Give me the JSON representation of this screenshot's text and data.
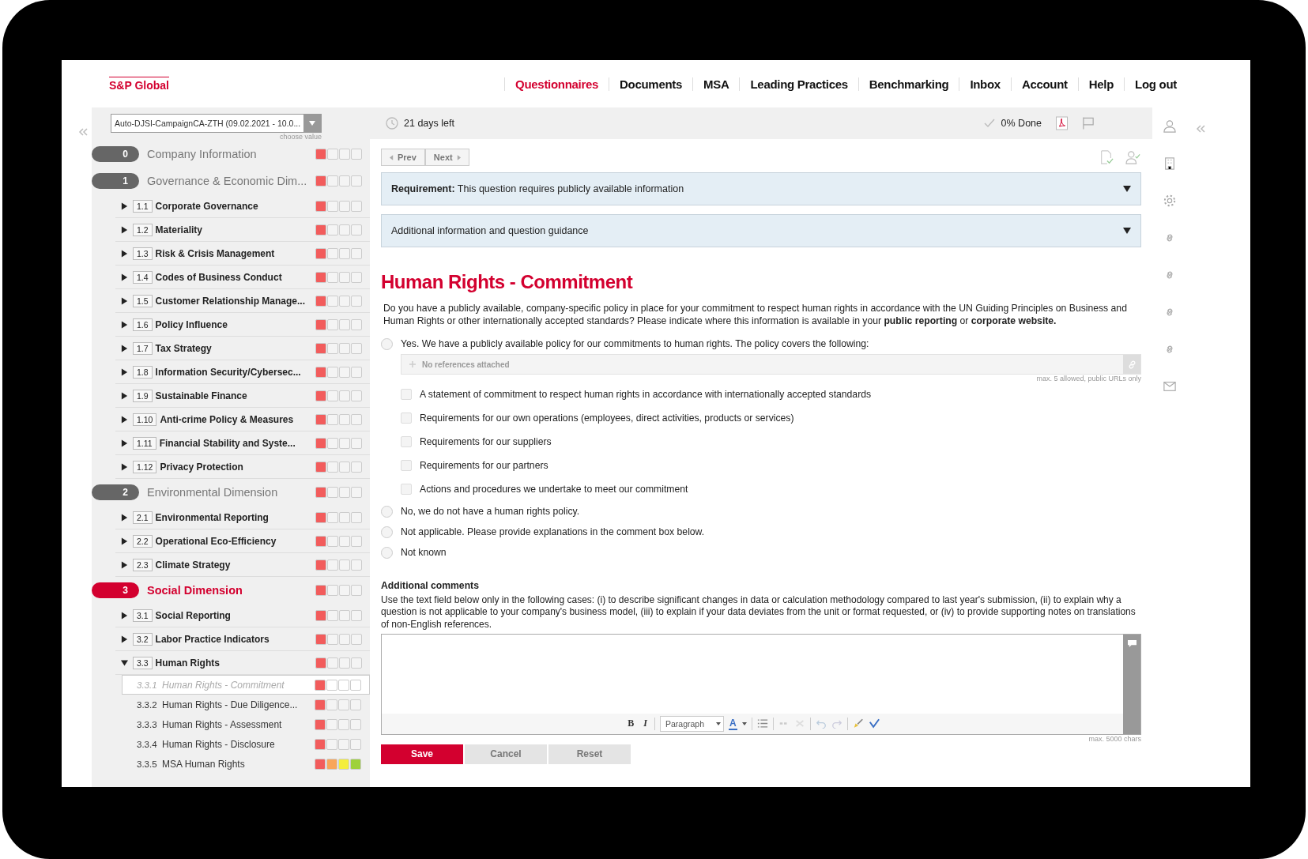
{
  "logo": "S&P Global",
  "nav": [
    {
      "label": "Questionnaires",
      "selected": true
    },
    {
      "label": "Documents",
      "selected": false
    },
    {
      "label": "MSA",
      "selected": false
    },
    {
      "label": "Leading Practices",
      "selected": false
    },
    {
      "label": "Benchmarking",
      "selected": false
    },
    {
      "label": "Inbox",
      "selected": false
    },
    {
      "label": "Account",
      "selected": false
    },
    {
      "label": "Help",
      "selected": false
    },
    {
      "label": "Log out",
      "selected": false
    }
  ],
  "sidebar": {
    "campaign_select": {
      "value": "Auto-DJSI-CampaignCA-ZTH (09.02.2021 - 10.0...",
      "hint": "choose value"
    },
    "sections": [
      {
        "number": "0",
        "title": "Company Information",
        "selected": false,
        "squares": [
          {
            "color": "#f25c5c"
          },
          {
            "color": "#f4f4f4"
          },
          {
            "color": "#f4f4f4"
          },
          {
            "color": "#f4f4f4"
          }
        ]
      },
      {
        "number": "1",
        "title": "Governance & Economic Dim...",
        "selected": false,
        "squares": [
          {
            "color": "#f25c5c"
          },
          {
            "color": "#f4f4f4"
          },
          {
            "color": "#f4f4f4"
          },
          {
            "color": "#f4f4f4"
          }
        ],
        "children": [
          {
            "number": "1.1",
            "title": "Corporate Governance",
            "expanded": false,
            "squares": [
              {
                "color": "#f25c5c"
              },
              {
                "color": "#f4f4f4"
              },
              {
                "color": "#f4f4f4"
              },
              {
                "color": "#f4f4f4"
              }
            ]
          },
          {
            "number": "1.2",
            "title": "Materiality",
            "expanded": false,
            "squares": [
              {
                "color": "#f25c5c"
              },
              {
                "color": "#f4f4f4"
              },
              {
                "color": "#f4f4f4"
              },
              {
                "color": "#f4f4f4"
              }
            ]
          },
          {
            "number": "1.3",
            "title": "Risk & Crisis Management",
            "expanded": false,
            "squares": [
              {
                "color": "#f25c5c"
              },
              {
                "color": "#f4f4f4"
              },
              {
                "color": "#f4f4f4"
              },
              {
                "color": "#f4f4f4"
              }
            ]
          },
          {
            "number": "1.4",
            "title": "Codes of Business Conduct",
            "expanded": false,
            "squares": [
              {
                "color": "#f25c5c"
              },
              {
                "color": "#f4f4f4"
              },
              {
                "color": "#f4f4f4"
              },
              {
                "color": "#f4f4f4"
              }
            ]
          },
          {
            "number": "1.5",
            "title": "Customer Relationship Manage...",
            "expanded": false,
            "squares": [
              {
                "color": "#f25c5c"
              },
              {
                "color": "#f4f4f4"
              },
              {
                "color": "#f4f4f4"
              },
              {
                "color": "#f4f4f4"
              }
            ]
          },
          {
            "number": "1.6",
            "title": "Policy Influence",
            "expanded": false,
            "squares": [
              {
                "color": "#f25c5c"
              },
              {
                "color": "#f4f4f4"
              },
              {
                "color": "#f4f4f4"
              },
              {
                "color": "#f4f4f4"
              }
            ]
          },
          {
            "number": "1.7",
            "title": "Tax Strategy",
            "expanded": false,
            "squares": [
              {
                "color": "#f25c5c"
              },
              {
                "color": "#f4f4f4"
              },
              {
                "color": "#f4f4f4"
              },
              {
                "color": "#f4f4f4"
              }
            ]
          },
          {
            "number": "1.8",
            "title": "Information Security/Cybersec...",
            "expanded": false,
            "squares": [
              {
                "color": "#f25c5c"
              },
              {
                "color": "#f4f4f4"
              },
              {
                "color": "#f4f4f4"
              },
              {
                "color": "#f4f4f4"
              }
            ]
          },
          {
            "number": "1.9",
            "title": "Sustainable Finance",
            "expanded": false,
            "squares": [
              {
                "color": "#f25c5c"
              },
              {
                "color": "#f4f4f4"
              },
              {
                "color": "#f4f4f4"
              },
              {
                "color": "#f4f4f4"
              }
            ]
          },
          {
            "number": "1.10",
            "title": "Anti-crime Policy & Measures",
            "expanded": false,
            "squares": [
              {
                "color": "#f25c5c"
              },
              {
                "color": "#f4f4f4"
              },
              {
                "color": "#f4f4f4"
              },
              {
                "color": "#f4f4f4"
              }
            ]
          },
          {
            "number": "1.11",
            "title": "Financial Stability and Syste...",
            "expanded": false,
            "squares": [
              {
                "color": "#f25c5c"
              },
              {
                "color": "#f4f4f4"
              },
              {
                "color": "#f4f4f4"
              },
              {
                "color": "#f4f4f4"
              }
            ]
          },
          {
            "number": "1.12",
            "title": "Privacy Protection",
            "expanded": false,
            "squares": [
              {
                "color": "#f25c5c"
              },
              {
                "color": "#f4f4f4"
              },
              {
                "color": "#f4f4f4"
              },
              {
                "color": "#f4f4f4"
              }
            ]
          }
        ]
      },
      {
        "number": "2",
        "title": "Environmental Dimension",
        "selected": false,
        "squares": [
          {
            "color": "#f25c5c"
          },
          {
            "color": "#f4f4f4"
          },
          {
            "color": "#f4f4f4"
          },
          {
            "color": "#f4f4f4"
          }
        ],
        "children": [
          {
            "number": "2.1",
            "title": "Environmental Reporting",
            "expanded": false,
            "squares": [
              {
                "color": "#f25c5c"
              },
              {
                "color": "#f4f4f4"
              },
              {
                "color": "#f4f4f4"
              },
              {
                "color": "#f4f4f4"
              }
            ]
          },
          {
            "number": "2.2",
            "title": "Operational Eco-Efficiency",
            "expanded": false,
            "squares": [
              {
                "color": "#f25c5c"
              },
              {
                "color": "#f4f4f4"
              },
              {
                "color": "#f4f4f4"
              },
              {
                "color": "#f4f4f4"
              }
            ]
          },
          {
            "number": "2.3",
            "title": "Climate Strategy",
            "expanded": false,
            "squares": [
              {
                "color": "#f25c5c"
              },
              {
                "color": "#f4f4f4"
              },
              {
                "color": "#f4f4f4"
              },
              {
                "color": "#f4f4f4"
              }
            ]
          }
        ]
      },
      {
        "number": "3",
        "title": "Social Dimension",
        "selected": true,
        "squares": [
          {
            "color": "#f25c5c"
          },
          {
            "color": "#f4f4f4"
          },
          {
            "color": "#f4f4f4"
          },
          {
            "color": "#f4f4f4"
          }
        ],
        "children": [
          {
            "number": "3.1",
            "title": "Social Reporting",
            "expanded": false,
            "squares": [
              {
                "color": "#f25c5c"
              },
              {
                "color": "#f4f4f4"
              },
              {
                "color": "#f4f4f4"
              },
              {
                "color": "#f4f4f4"
              }
            ]
          },
          {
            "number": "3.2",
            "title": "Labor Practice Indicators",
            "expanded": false,
            "squares": [
              {
                "color": "#f25c5c"
              },
              {
                "color": "#f4f4f4"
              },
              {
                "color": "#f4f4f4"
              },
              {
                "color": "#f4f4f4"
              }
            ]
          },
          {
            "number": "3.3",
            "title": "Human Rights",
            "expanded": true,
            "squares": [
              {
                "color": "#f25c5c"
              },
              {
                "color": "#f4f4f4"
              },
              {
                "color": "#f4f4f4"
              },
              {
                "color": "#f4f4f4"
              }
            ],
            "children": [
              {
                "number": "3.3.1",
                "title": "Human Rights - Commitment",
                "selected": true,
                "squares": [
                  {
                    "color": "#f25c5c"
                  },
                  {
                    "color": "#ffffff"
                  },
                  {
                    "color": "#ffffff"
                  },
                  {
                    "color": "#ffffff"
                  }
                ]
              },
              {
                "number": "3.3.2",
                "title": "Human Rights - Due Diligence...",
                "selected": false,
                "squares": [
                  {
                    "color": "#f25c5c"
                  },
                  {
                    "color": "#f4f4f4"
                  },
                  {
                    "color": "#f4f4f4"
                  },
                  {
                    "color": "#f4f4f4"
                  }
                ]
              },
              {
                "number": "3.3.3",
                "title": "Human Rights - Assessment",
                "selected": false,
                "squares": [
                  {
                    "color": "#f25c5c"
                  },
                  {
                    "color": "#f4f4f4"
                  },
                  {
                    "color": "#f4f4f4"
                  },
                  {
                    "color": "#f4f4f4"
                  }
                ]
              },
              {
                "number": "3.3.4",
                "title": "Human Rights - Disclosure",
                "selected": false,
                "squares": [
                  {
                    "color": "#f25c5c"
                  },
                  {
                    "color": "#f4f4f4"
                  },
                  {
                    "color": "#f4f4f4"
                  },
                  {
                    "color": "#f4f4f4"
                  }
                ]
              },
              {
                "number": "3.3.5",
                "title": "MSA Human Rights",
                "selected": false,
                "squares": [
                  {
                    "color": "#f25c5c"
                  },
                  {
                    "color": "#f9a65a"
                  },
                  {
                    "color": "#f4ee3c"
                  },
                  {
                    "color": "#9ed13a"
                  }
                ]
              }
            ]
          }
        ]
      }
    ]
  },
  "topbar": {
    "days_left": "21 days left",
    "done": "0% Done"
  },
  "pager": {
    "prev": "Prev",
    "next": "Next"
  },
  "accordions": [
    {
      "text": "**Requirement:** This question requires publicly available information"
    },
    {
      "text": "Additional information and question guidance"
    }
  ],
  "question": {
    "title": "Human Rights - Commitment",
    "text": "Do you have a publicly available, company-specific policy in place for your commitment to respect human rights in accordance with the UN Guiding Principles on Business and Human Rights or other internationally accepted standards? Please indicate where this information is available in your **public reporting** or **corporate website.**",
    "options": [
      {
        "label": "Yes. We have a publicly available policy for our commitments to human rights. The policy covers the following:",
        "selected": false,
        "references": {
          "placeholder": "No references attached",
          "note": "max. 5 allowed, public URLs only"
        },
        "sub_options": [
          {
            "label": "A statement of commitment to respect human rights in accordance with internationally accepted standards",
            "checked": false
          },
          {
            "label": "Requirements for our own operations (employees, direct activities, products or services)",
            "checked": false
          },
          {
            "label": "Requirements for our suppliers",
            "checked": false
          },
          {
            "label": "Requirements for our partners",
            "checked": false
          },
          {
            "label": "Actions and procedures we undertake to meet our commitment",
            "checked": false
          }
        ]
      },
      {
        "label": "No, we do not have a human rights policy.",
        "selected": false
      },
      {
        "label": "Not applicable. Please provide explanations in the comment box below.",
        "selected": false
      },
      {
        "label": "Not known",
        "selected": false
      }
    ]
  },
  "comments": {
    "heading": "Additional comments",
    "text": "Use the text field below only in the following cases: (i) to describe significant changes in data or calculation methodology compared to last year's submission, (ii) to explain why a question is not applicable to your company's business model, (iii) to explain if your data deviates from the unit or format requested, or (iv) to provide supporting notes on translations of non-English references.",
    "toolbar": {
      "bold": "B",
      "italic": "I",
      "format": "Paragraph",
      "font_color_label": "A"
    },
    "note": "max. 5000 chars"
  },
  "buttons": [
    {
      "label": "Save",
      "kind": "primary"
    },
    {
      "label": "Cancel",
      "kind": "secondary"
    },
    {
      "label": "Reset",
      "kind": "secondary"
    }
  ]
}
